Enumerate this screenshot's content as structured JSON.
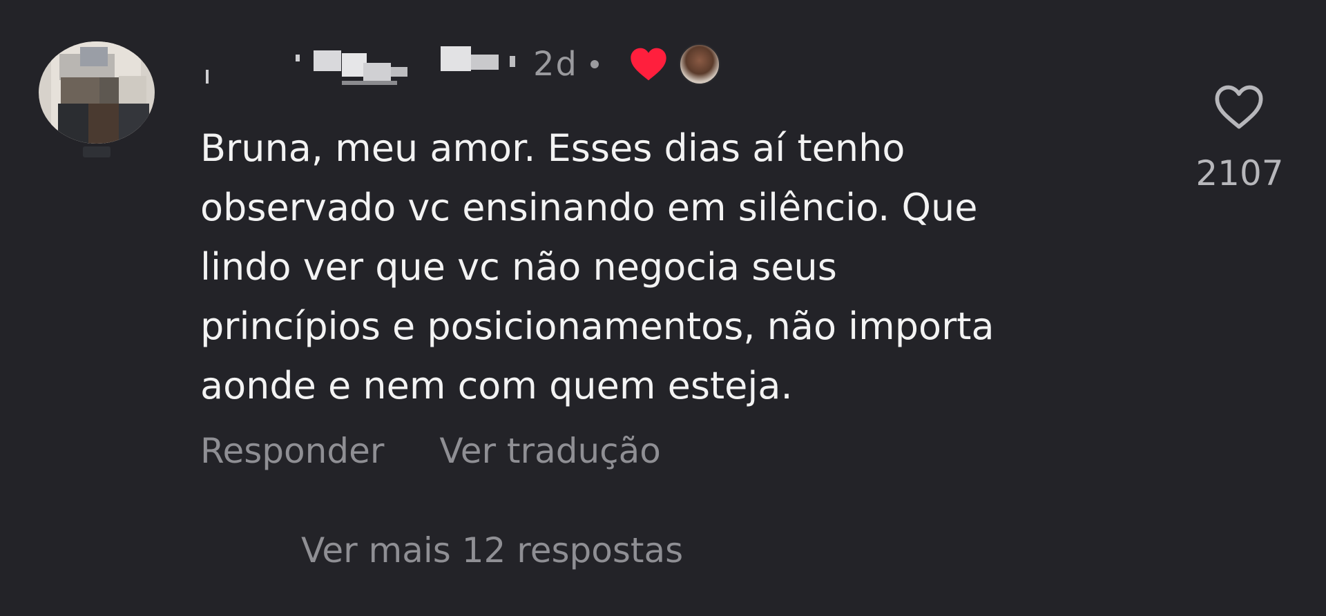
{
  "comment": {
    "time": "2d",
    "body_lines": [
      "Bruna, meu amor. Esses dias aí tenho",
      "observado vc ensinando em silêncio. Que",
      "lindo ver que vc não negocia seus",
      "princípios e posicionamentos, não importa",
      "aonde e nem com quem esteja."
    ],
    "reply_label": "Responder",
    "translate_label": "Ver tradução",
    "more_replies_label": "Ver mais 12 respostas",
    "like_count": "2107"
  },
  "icons": {
    "creator_heart": "heart-filled-icon",
    "like": "heart-outline-icon"
  },
  "colors": {
    "background": "#232328",
    "creator_heart": "#ff1f3d",
    "muted_text": "#8f8f94"
  }
}
